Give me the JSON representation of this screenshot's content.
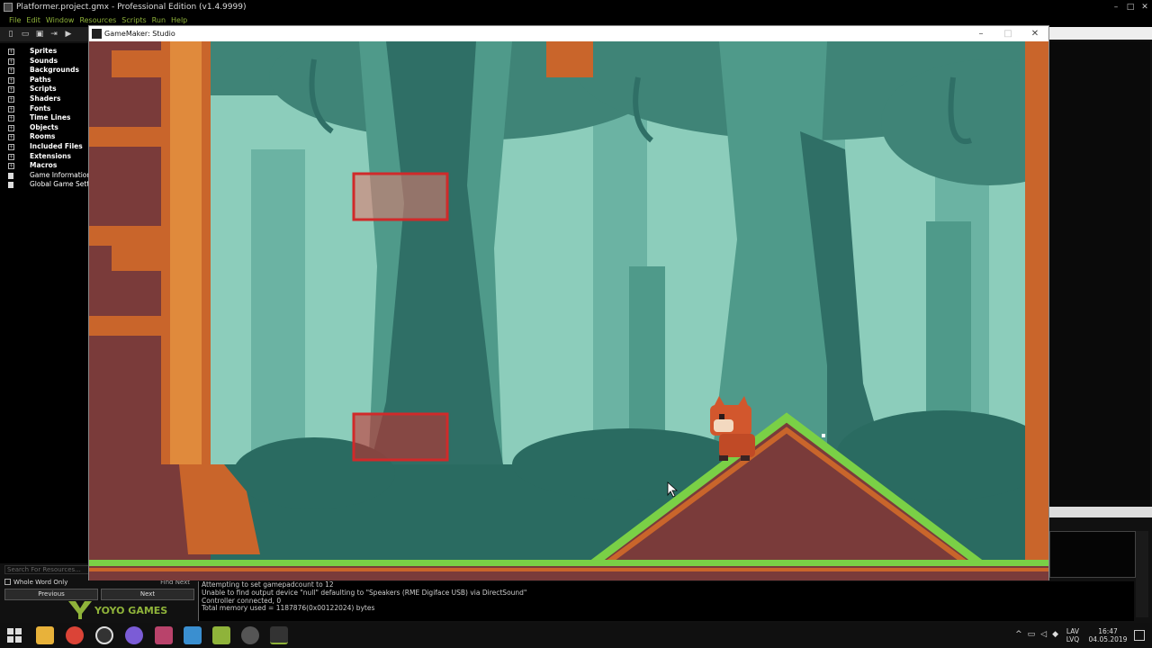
{
  "ide": {
    "title": "Platformer.project.gmx  -  Professional Edition (v1.4.9999)",
    "menu": [
      "File",
      "Edit",
      "Window",
      "Resources",
      "Scripts",
      "Run",
      "Help"
    ],
    "tree": [
      {
        "label": "Sprites",
        "kind": "folder"
      },
      {
        "label": "Sounds",
        "kind": "folder"
      },
      {
        "label": "Backgrounds",
        "kind": "folder"
      },
      {
        "label": "Paths",
        "kind": "folder"
      },
      {
        "label": "Scripts",
        "kind": "folder"
      },
      {
        "label": "Shaders",
        "kind": "folder"
      },
      {
        "label": "Fonts",
        "kind": "folder"
      },
      {
        "label": "Time Lines",
        "kind": "folder"
      },
      {
        "label": "Objects",
        "kind": "folder"
      },
      {
        "label": "Rooms",
        "kind": "folder"
      },
      {
        "label": "Included Files",
        "kind": "folder"
      },
      {
        "label": "Extensions",
        "kind": "folder"
      },
      {
        "label": "Macros",
        "kind": "folder"
      },
      {
        "label": "Game Information",
        "kind": "file"
      },
      {
        "label": "Global Game Settings",
        "kind": "file"
      }
    ],
    "search_placeholder": "Search For Resources...",
    "whole_word_label": "Whole Word Only",
    "find_label": "Find Next",
    "previous_label": "Previous",
    "next_label": "Next",
    "logo_text": "YOYO GAMES",
    "output_lines": [
      "Attempting to set gamepadcount to 12",
      "Unable to find output device \"null\" defaulting to \"Speakers (RME Digiface USB) via DirectSound\"",
      "Controller connected, 0",
      "Total memory used = 1187876(0x00122024) bytes"
    ]
  },
  "game_window": {
    "title": "GameMaker: Studio"
  },
  "taskbar": {
    "lang": "LAV\nLVQ",
    "time": "16:47",
    "date": "04.05.2019"
  },
  "colors": {
    "accent_green": "#8fb33a",
    "forest_far": "#8ccdbb",
    "forest_mid": "#4f9a8a",
    "forest_near": "#2f6f66",
    "dirt": "#7a3b3a",
    "grass": "#7ad046",
    "rock": "#c9652b"
  }
}
